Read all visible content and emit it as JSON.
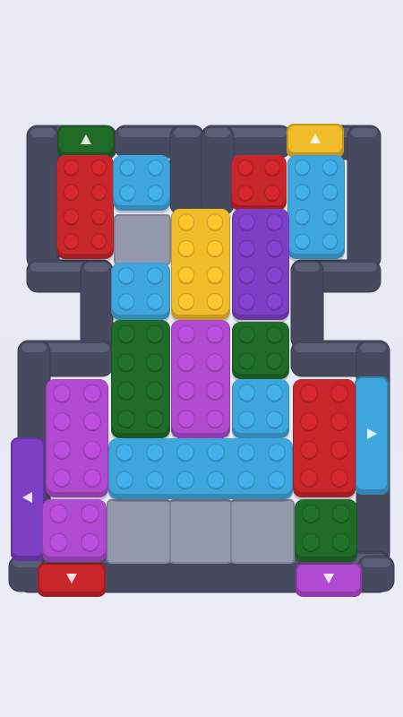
{
  "game": {
    "name": "brick-jam-puzzle",
    "colors": {
      "red": "#c8262b",
      "blue": "#3fa6dd",
      "yellow": "#f1bc2a",
      "purple": "#7d3fc4",
      "green": "#1f6b27",
      "magenta": "#b04ad0",
      "wall": "#474a5e",
      "floor": "#9499ab"
    },
    "gates": [
      {
        "id": "gate-top-green",
        "color": "green",
        "direction": "up"
      },
      {
        "id": "gate-top-yellow",
        "color": "yellow",
        "direction": "up"
      },
      {
        "id": "gate-right-blue",
        "color": "blue",
        "direction": "right"
      },
      {
        "id": "gate-left-purple",
        "color": "purple",
        "direction": "left"
      },
      {
        "id": "gate-bottom-red",
        "color": "red",
        "direction": "down"
      },
      {
        "id": "gate-bottom-magenta",
        "color": "magenta",
        "direction": "down"
      }
    ],
    "blocks": [
      {
        "id": "red-2x4-top-left",
        "color": "red",
        "studs_w": 2,
        "studs_h": 4
      },
      {
        "id": "blue-2x2-top",
        "color": "blue",
        "studs_w": 2,
        "studs_h": 2
      },
      {
        "id": "red-2x2-top",
        "color": "red",
        "studs_w": 2,
        "studs_h": 2
      },
      {
        "id": "blue-2x4-top-right",
        "color": "blue",
        "studs_w": 2,
        "studs_h": 4
      },
      {
        "id": "yellow-2x4",
        "color": "yellow",
        "studs_w": 2,
        "studs_h": 4
      },
      {
        "id": "purple-2x4",
        "color": "purple",
        "studs_w": 2,
        "studs_h": 4
      },
      {
        "id": "blue-2x2-mid",
        "color": "blue",
        "studs_w": 2,
        "studs_h": 2
      },
      {
        "id": "green-2x4",
        "color": "green",
        "studs_w": 2,
        "studs_h": 4
      },
      {
        "id": "magenta-2x4-center",
        "color": "magenta",
        "studs_w": 2,
        "studs_h": 4
      },
      {
        "id": "green-2x2-mid",
        "color": "green",
        "studs_w": 2,
        "studs_h": 2
      },
      {
        "id": "blue-2x2-right",
        "color": "blue",
        "studs_w": 2,
        "studs_h": 2
      },
      {
        "id": "magenta-2x4-left",
        "color": "magenta",
        "studs_w": 2,
        "studs_h": 4
      },
      {
        "id": "red-2x4-right",
        "color": "red",
        "studs_w": 2,
        "studs_h": 4
      },
      {
        "id": "blue-6x2-long",
        "color": "blue",
        "studs_w": 6,
        "studs_h": 2
      },
      {
        "id": "magenta-2x2-bottom",
        "color": "magenta",
        "studs_w": 2,
        "studs_h": 2
      },
      {
        "id": "green-2x2-bottom",
        "color": "green",
        "studs_w": 2,
        "studs_h": 2
      }
    ]
  }
}
